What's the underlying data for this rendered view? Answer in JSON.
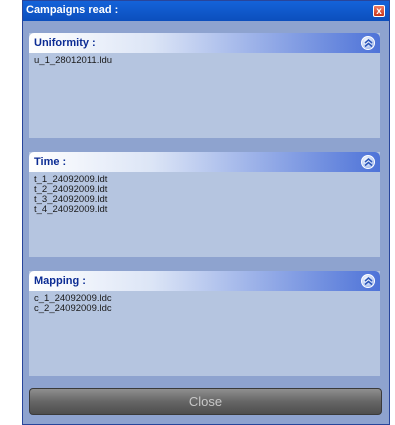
{
  "window": {
    "title": "Campaigns read :",
    "close_glyph": "x"
  },
  "panels": [
    {
      "title": "Uniformity :",
      "files": [
        "u_1_28012011.ldu"
      ]
    },
    {
      "title": "Time :",
      "files": [
        "t_1_24092009.ldt",
        "t_2_24092009.ldt",
        "t_3_24092009.ldt",
        "t_4_24092009.ldt"
      ]
    },
    {
      "title": "Mapping :",
      "files": [
        "c_1_24092009.ldc",
        "c_2_24092009.ldc"
      ]
    }
  ],
  "footer": {
    "close_label": "Close"
  },
  "icons": {
    "collapse": "chevron-up-icon",
    "window_close": "close-icon"
  },
  "colors": {
    "titlebar": "#0c4fbd",
    "panel_background": "#b5c5e0",
    "panel_title": "#0c2c94",
    "button_gray": "#666666"
  }
}
